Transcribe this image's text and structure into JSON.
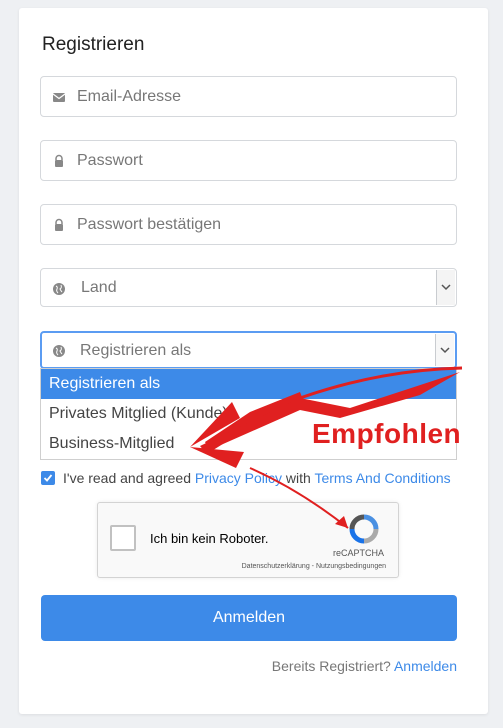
{
  "form": {
    "title": "Registrieren",
    "email_placeholder": "Email-Adresse",
    "password_placeholder": "Passwort",
    "password_confirm_placeholder": "Passwort bestätigen",
    "country_select": "Land",
    "register_as_select": "Registrieren als",
    "dropdown_options": [
      "Registrieren als",
      "Privates Mitglied (Kunde)",
      "Business-Mitglied"
    ],
    "selected_option": "Registrieren als",
    "agree_prefix": "I've read and agreed",
    "privacy_link": "Privacy Policy",
    "agree_with": "with",
    "terms_link": "Terms And Conditions",
    "agree_checked": true,
    "submit_label": "Anmelden",
    "already_text": "Bereits Registriert?",
    "login_link": "Anmelden"
  },
  "captcha": {
    "label": "Ich bin kein Roboter.",
    "brand": "reCAPTCHA",
    "terms": "Datenschutzerklärung - Nutzungsbedingungen"
  },
  "annotation": {
    "text": "Empfohlen",
    "color": "#e02020"
  },
  "colors": {
    "accent": "#3d8ae8"
  }
}
